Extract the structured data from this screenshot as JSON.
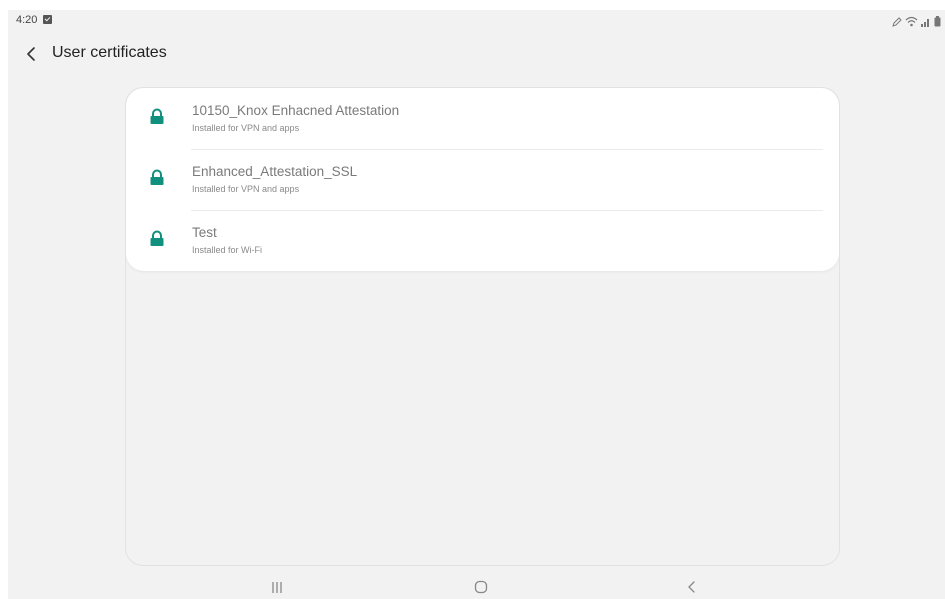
{
  "status_bar": {
    "time": "4:20"
  },
  "header": {
    "title": "User certificates"
  },
  "certificates": [
    {
      "name": "10150_Knox Enhacned Attestation",
      "detail": "Installed for VPN and apps"
    },
    {
      "name": "Enhanced_Attestation_SSL",
      "detail": "Installed for VPN and apps"
    },
    {
      "name": "Test",
      "detail": "Installed for Wi-Fi"
    }
  ],
  "icons": {
    "back": "chevron-left-icon",
    "certificate": "lock-icon",
    "status": [
      "checkbox-notification-icon",
      "edit-pen-icon",
      "wifi-icon",
      "signal-icon",
      "battery-icon"
    ],
    "nav": [
      "recents-icon",
      "home-icon",
      "back-icon"
    ]
  },
  "colors": {
    "accent": "#12907e",
    "background": "#f2f2f2",
    "card": "#ffffff",
    "title_text": "#7a7a7a",
    "sub_text": "#8a8a8a"
  }
}
